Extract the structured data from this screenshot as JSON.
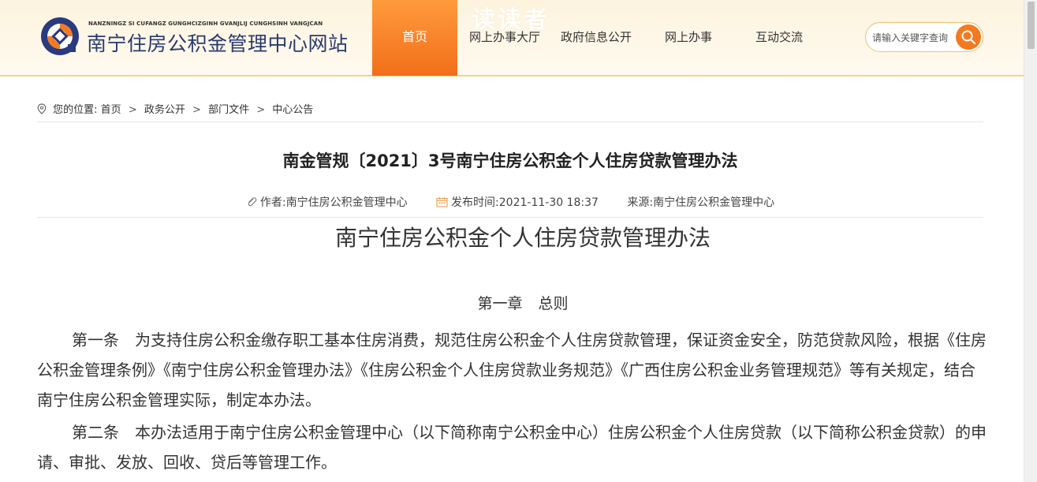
{
  "header": {
    "site_subtitle": "NANZNINGZ SI CUFANGZ GUNGHCIZGINH GVANJLIJ CUNGHSINH VANGJCAN",
    "site_title": "南宁住房公积金管理中心网站",
    "watermark": "读读者",
    "nav": [
      {
        "label": "首页",
        "active": true
      },
      {
        "label": "网上办事大厅"
      },
      {
        "label": "政府信息公开"
      },
      {
        "label": "网上办事"
      },
      {
        "label": "互动交流"
      }
    ],
    "search": {
      "placeholder": "请输入关键字查询"
    },
    "accent_color": "#f47a20"
  },
  "breadcrumb": {
    "prefix": "您的位置:",
    "items": [
      "首页",
      "政务公开",
      "部门文件",
      "中心公告"
    ],
    "separator": ">"
  },
  "article": {
    "title": "南金管规〔2021〕3号南宁住房公积金个人住房贷款管理办法",
    "author_label": "作者:",
    "author": "南宁住房公积金管理中心",
    "time_label": "发布时间:",
    "time": "2021-11-30 18:37",
    "source_label": "来源:",
    "source": "南宁住房公积金管理中心",
    "doc_heading": "南宁住房公积金个人住房贷款管理办法",
    "chapter": "第一章 总则",
    "paragraphs": [
      {
        "no": "第一条",
        "text": "为支持住房公积金缴存职工基本住房消费，规范住房公积金个人住房贷款管理，保证资金安全，防范贷款风险，根据《住房公积金管理条例》《南宁住房公积金管理办法》《住房公积金个人住房贷款业务规范》《广西住房公积金业务管理规范》等有关规定，结合南宁住房公积金管理实际，制定本办法。"
      },
      {
        "no": "第二条",
        "text": "本办法适用于南宁住房公积金管理中心（以下简称南宁公积金中心）住房公积金个人住房贷款（以下简称公积金贷款）的申请、审批、发放、回收、贷后等管理工作。"
      }
    ]
  }
}
